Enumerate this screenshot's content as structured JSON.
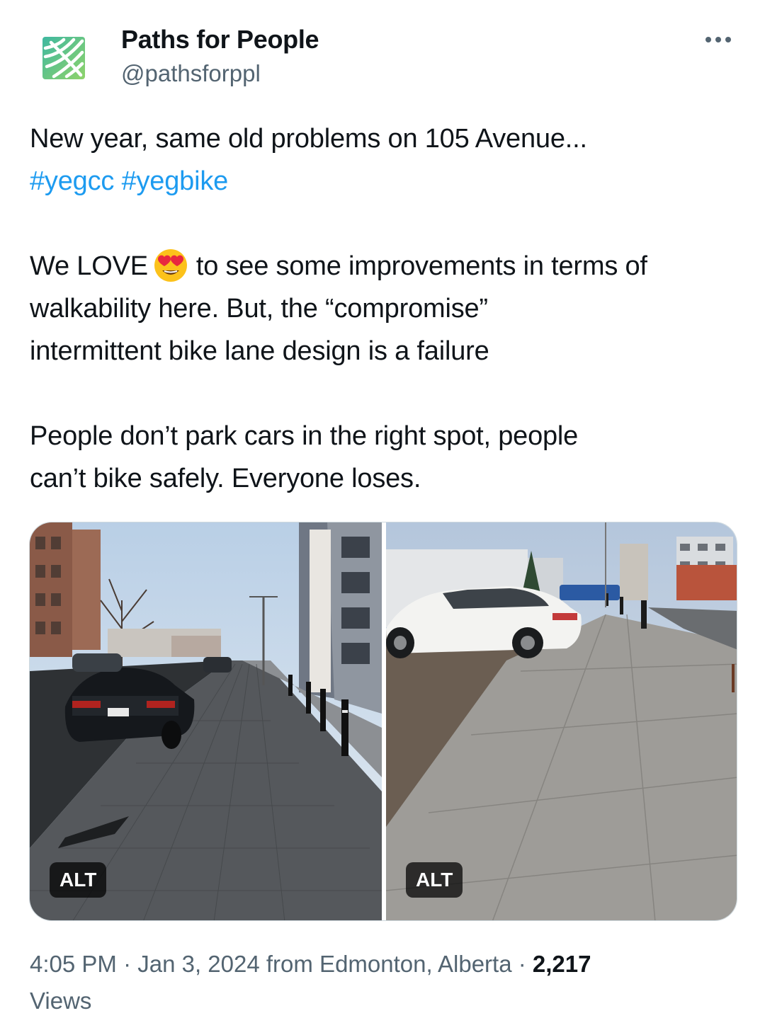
{
  "author": {
    "display_name": "Paths for People",
    "handle": "@pathsforppl",
    "avatar_icon": "paths-for-people-logo",
    "brand_color": "#5bc28a"
  },
  "more_icon": "more-horizontal-icon",
  "tweet": {
    "line1": "New year, same old problems on 105 Avenue...",
    "hashtag1": "#yegcc",
    "hashtag2": "#yegbike",
    "line3_before_emoji": "We LOVE",
    "emoji": "smiling-face-with-heart-eyes",
    "line3_after_emoji": "to see some improvements in terms of",
    "line4": "walkability here. But, the “compromise”",
    "line5": "intermittent bike lane design is a failure",
    "line6": "People don’t park cars in the right spot, people",
    "line7": "can’t bike safely. Everyone loses."
  },
  "media": [
    {
      "alt_badge": "ALT",
      "description_icon": "photo-street-bike-lane"
    },
    {
      "alt_badge": "ALT",
      "description_icon": "photo-car-parked-on-sidewalk"
    }
  ],
  "meta": {
    "time": "4:05 PM",
    "date": "Jan 3, 2024",
    "location": "from Edmonton, Alberta",
    "views_count": "2,217",
    "views_label": "Views"
  },
  "colors": {
    "link": "#1d9bf0",
    "secondary_text": "#536471",
    "primary_text": "#0f1419"
  }
}
